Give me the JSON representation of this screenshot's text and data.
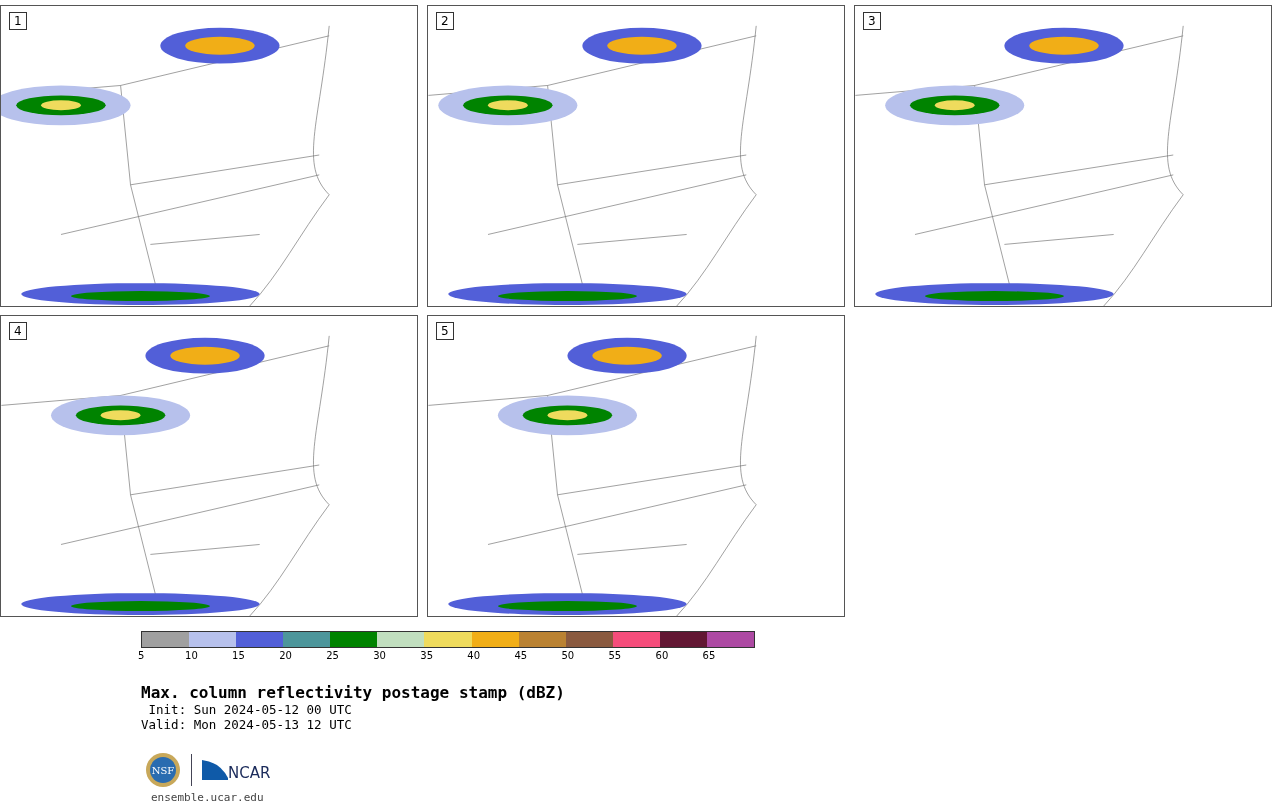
{
  "panels": [
    {
      "label": "1"
    },
    {
      "label": "2"
    },
    {
      "label": "3"
    },
    {
      "label": "4"
    },
    {
      "label": "5"
    }
  ],
  "colorbar": {
    "segments": [
      {
        "label": "5",
        "color": "#a0a0a0"
      },
      {
        "label": "10",
        "color": "#b7c1ec"
      },
      {
        "label": "15",
        "color": "#525fd8"
      },
      {
        "label": "20",
        "color": "#4d969b"
      },
      {
        "label": "25",
        "color": "#008300"
      },
      {
        "label": "30",
        "color": "#c1dfbf"
      },
      {
        "label": "35",
        "color": "#efdb5d"
      },
      {
        "label": "40",
        "color": "#f1ae17"
      },
      {
        "label": "45",
        "color": "#ba8232"
      },
      {
        "label": "50",
        "color": "#8a5a3f"
      },
      {
        "label": "55",
        "color": "#f54d7b"
      },
      {
        "label": "60",
        "color": "#621733"
      },
      {
        "label": "65",
        "color": "#ad4aa3"
      }
    ]
  },
  "title": "Max. column reflectivity postage stamp (dBZ)",
  "init": " Init: Sun 2024-05-12 00 UTC",
  "valid": "Valid: Mon 2024-05-13 12 UTC",
  "logo": {
    "nsf": "NSF",
    "ncar": "NCAR"
  },
  "url": "ensemble.ucar.edu"
}
